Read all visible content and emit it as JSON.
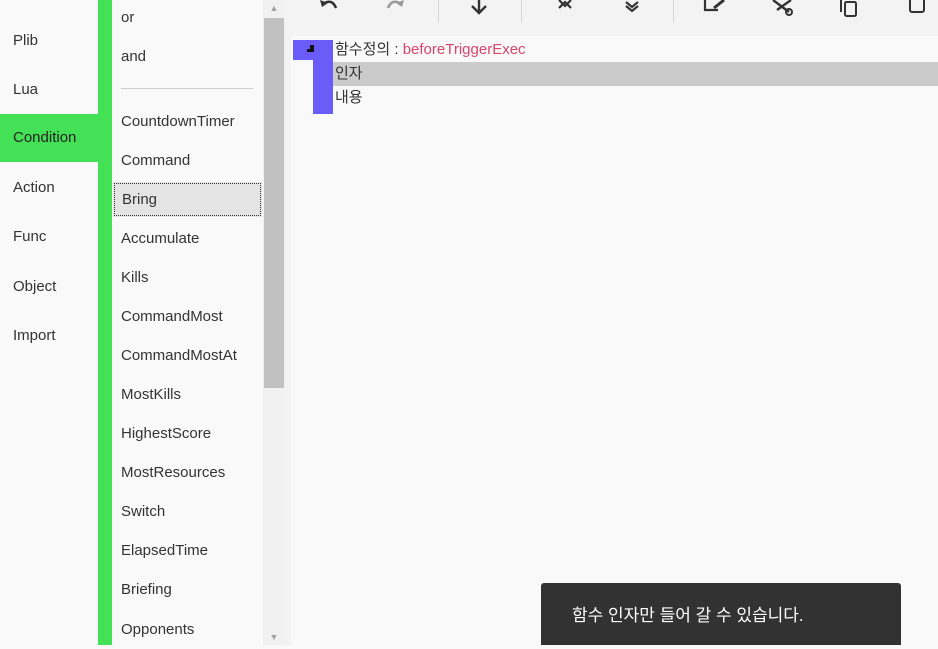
{
  "nav": {
    "items": [
      {
        "label": "Plib"
      },
      {
        "label": "Lua"
      },
      {
        "label": "Condition"
      },
      {
        "label": "Action"
      },
      {
        "label": "Func"
      },
      {
        "label": "Object"
      },
      {
        "label": "Import"
      }
    ],
    "active_index": 2
  },
  "condition_list": {
    "items": [
      {
        "label": "or"
      },
      {
        "label": "and"
      },
      {
        "label": "CountdownTimer"
      },
      {
        "label": "Command"
      },
      {
        "label": "Bring"
      },
      {
        "label": "Accumulate"
      },
      {
        "label": "Kills"
      },
      {
        "label": "CommandMost"
      },
      {
        "label": "CommandMostAt"
      },
      {
        "label": "MostKills"
      },
      {
        "label": "HighestScore"
      },
      {
        "label": "MostResources"
      },
      {
        "label": "Switch"
      },
      {
        "label": "ElapsedTime"
      },
      {
        "label": "Briefing"
      },
      {
        "label": "Opponents"
      }
    ],
    "selected_index": 4
  },
  "toolbar": {
    "icons": [
      "undo-icon",
      "redo-icon",
      "move-down-icon",
      "collapse-icon",
      "expand-icon",
      "edit-icon",
      "cut-icon",
      "copy-icon",
      "paste-icon"
    ]
  },
  "editor": {
    "function_label": "함수정의 : ",
    "function_name": "beforeTriggerExec",
    "args_label": "인자",
    "body_label": "내용"
  },
  "toast": {
    "message": "함수 인자만 들어 갈 수 있습니다."
  },
  "colors": {
    "accent_green": "#44e055",
    "block_purple": "#6a5cf8",
    "function_name_red": "#d6456a",
    "toast_bg": "#323232"
  }
}
